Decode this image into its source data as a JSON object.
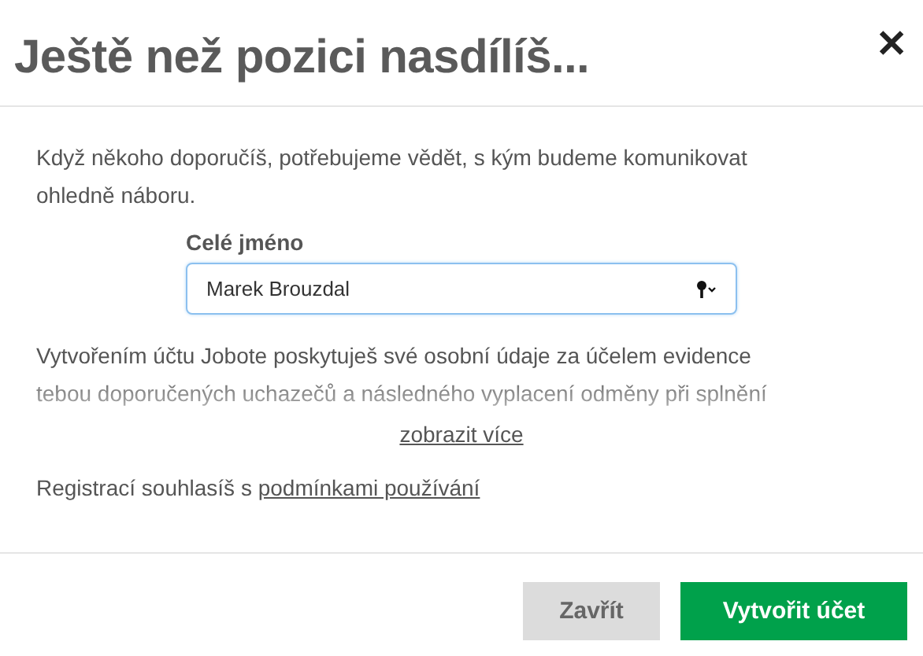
{
  "dialog": {
    "title": "Ještě než pozici nasdílíš...",
    "close": "✕"
  },
  "intro": "Když někoho doporučíš, potřebujeme vědět, s kým budeme komunikovat ohledně náboru.",
  "field": {
    "label": "Celé jméno",
    "value": "Marek Brouzdal"
  },
  "consent": "Vytvořením účtu Jobote poskytuješ své osobní údaje za účelem evidence tebou doporučených uchazečů a následného vyplacení odměny při splnění",
  "show_more": "zobrazit více",
  "terms": {
    "text": "Registrací souhlasíš s",
    "link": "podmínkami používání"
  },
  "buttons": [
    {
      "label": "Zavřít",
      "kind": "secondary"
    },
    {
      "label": "Vytvořit účet",
      "kind": "primary"
    }
  ]
}
